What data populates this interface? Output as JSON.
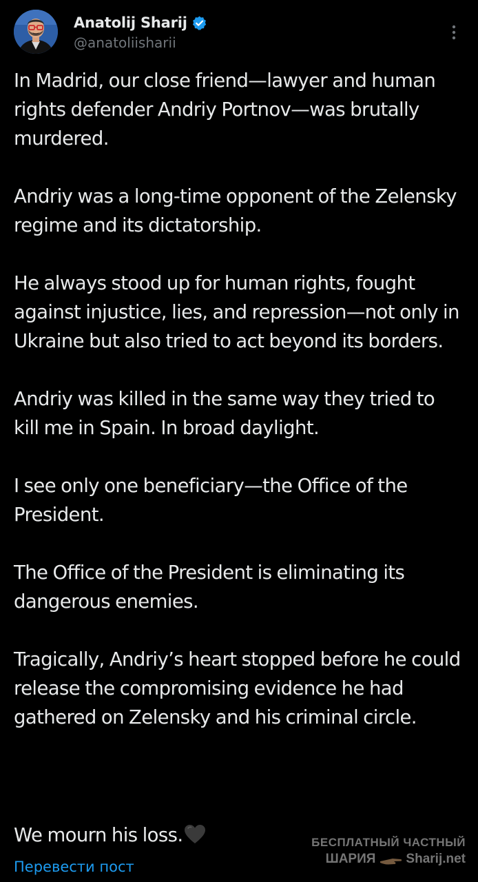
{
  "author": {
    "display_name": "Anatolij Sharij",
    "handle": "@anatoliisharii",
    "verified": true,
    "avatar_icon": "avatar-portrait",
    "verified_badge_color": "#1d9bf0"
  },
  "menu": {
    "more_icon": "vertical-ellipsis-icon"
  },
  "tweet": {
    "paragraphs": [
      "In Madrid, our close friend—lawyer and human rights defender Andriy Portnov—was brutally murdered.",
      "Andriy was a long-time opponent of the Zelensky regime and its dictatorship.",
      "He always stood up for human rights, fought against injustice, lies, and repression—not only in Ukraine but also tried to act beyond its borders.",
      "Andriy was killed in the same way they tried to kill me in Spain. In broad daylight.",
      "I see only one beneficiary—the Office of the President.",
      "The Office of the President is eliminating its dangerous enemies.",
      "Tragically, Andriy’s heart stopped before he could release the compromising evidence he had gathered on Zelensky and his criminal circle."
    ],
    "closing": "We mourn his loss.",
    "closing_emoji": "black-heart-icon"
  },
  "translate_link": "Перевести пост",
  "watermark": {
    "line1": "БЕСПЛАТНЫЙ ЧАСТНЫЙ",
    "line2_left": "ШАРИЯ",
    "line2_right": "Sharij.net"
  },
  "colors": {
    "background": "#000000",
    "text": "#e7e9ea",
    "secondary_text": "#71767b",
    "link": "#1d9bf0"
  }
}
